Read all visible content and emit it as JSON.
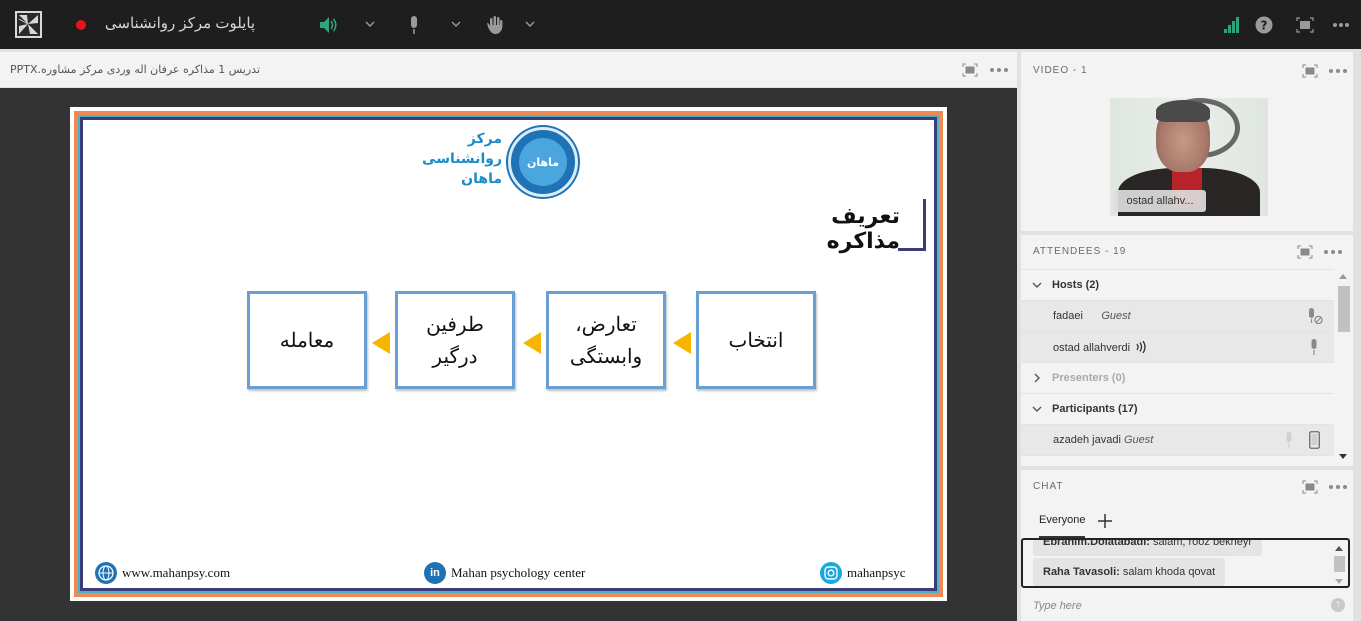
{
  "topbar": {
    "meeting_title": "پایلوت مرکز روانشناسی",
    "recording": true,
    "icons": {
      "app_logo": "adobe-connect-logo",
      "speaker": "speaker-on-icon",
      "mic": "microphone-icon",
      "raise_hand": "raise-hand-icon",
      "signal": "connection-strength-icon",
      "help": "help-icon",
      "fullscreen": "fullscreen-icon",
      "more": "more-options-icon"
    },
    "colors": {
      "record": "#e8131a",
      "active": "#2fa37a"
    }
  },
  "share_pod": {
    "title": "تدریس 1 مذاکره عرفان اله وردی مرکز مشاوره.PPTX",
    "slide": {
      "logo_text": [
        "مرکز",
        "روانشناسی",
        "ماهان"
      ],
      "logo_badge_text": "ماهان",
      "heading": "تعریف مذاکره",
      "flow_steps": [
        "انتخاب",
        "تعارض، وابستگی",
        "طرفین درگیر",
        "معامله"
      ],
      "footer": {
        "website": "www.mahanpsy.com",
        "linkedin": "Mahan psychology center",
        "instagram": "mahanpsyc"
      }
    }
  },
  "video_pod": {
    "title": "VIDEO",
    "count_label": "- 1",
    "speaker_name": "ostad allahv..."
  },
  "attendees_pod": {
    "title": "ATTENDEES",
    "count_label": "- 19",
    "groups": [
      {
        "label": "Hosts (2)",
        "expanded": true,
        "members": [
          {
            "name": "fadaei",
            "role": "Guest",
            "mic": "mic-disabled"
          },
          {
            "name": "ostad allahverdi",
            "role": "",
            "speaking": true,
            "mic": "mic-on"
          }
        ]
      },
      {
        "label": "Presenters (0)",
        "expanded": false,
        "members": []
      },
      {
        "label": "Participants (17)",
        "expanded": true,
        "members": [
          {
            "name": "azadeh javadi",
            "role": "Guest",
            "mic": "mic-off",
            "device": "mobile"
          }
        ]
      }
    ]
  },
  "chat_pod": {
    "title": "CHAT",
    "tab": "Everyone",
    "messages": [
      {
        "sender": "Ebrahim.Dolatabadi:",
        "text": "salam, rooz bekheyr"
      },
      {
        "sender": "Raha Tavasoli:",
        "text": "salam khoda qovat"
      }
    ],
    "input_placeholder": "Type here"
  }
}
